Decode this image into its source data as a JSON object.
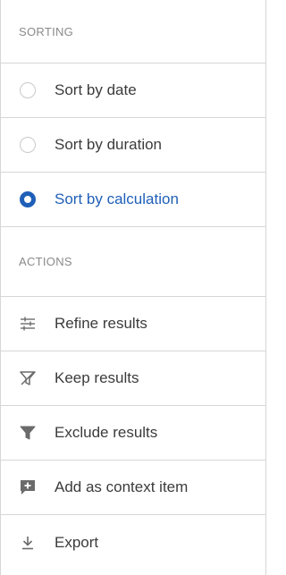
{
  "sorting": {
    "header": "SORTING",
    "options": [
      {
        "label": "Sort by date",
        "selected": false
      },
      {
        "label": "Sort by duration",
        "selected": false
      },
      {
        "label": "Sort by calculation",
        "selected": true
      }
    ]
  },
  "actions": {
    "header": "ACTIONS",
    "items": [
      {
        "label": "Refine results",
        "icon": "sliders-icon"
      },
      {
        "label": "Keep results",
        "icon": "filter-keep-icon"
      },
      {
        "label": "Exclude results",
        "icon": "filter-icon"
      },
      {
        "label": "Add as context item",
        "icon": "add-comment-icon"
      },
      {
        "label": "Export",
        "icon": "download-icon"
      }
    ]
  },
  "colors": {
    "accent": "#1f5fb8",
    "text": "#3b3b3b",
    "muted": "#8a8a8a",
    "divider": "#d6d6d6",
    "icon": "#6b6b6b"
  }
}
